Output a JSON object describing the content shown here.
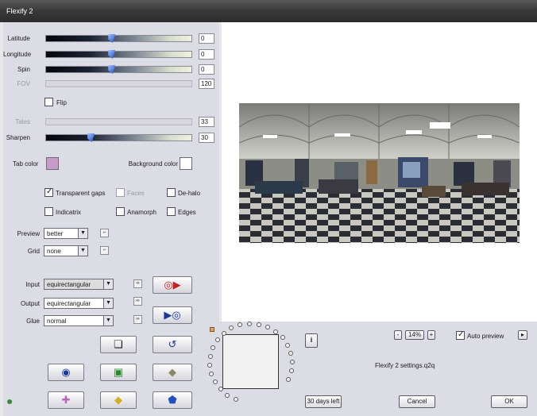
{
  "window": {
    "title": "Flexify 2"
  },
  "sliders": [
    {
      "label": "Latitude",
      "value": "0",
      "fraction": 0.45,
      "enabled": true
    },
    {
      "label": "Longitude",
      "value": "0",
      "fraction": 0.45,
      "enabled": true
    },
    {
      "label": "Spin",
      "value": "0",
      "fraction": 0.45,
      "enabled": true
    },
    {
      "label": "FOV",
      "value": "120",
      "fraction": 0.0,
      "enabled": false
    },
    {
      "label": "Tales",
      "value": "33",
      "fraction": 0.0,
      "enabled": false
    },
    {
      "label": "Sharpen",
      "value": "30",
      "fraction": 0.3,
      "enabled": true
    }
  ],
  "flip": {
    "label": "Flip",
    "checked": false
  },
  "colors": {
    "tab_label": "Tab color",
    "tab_color": "#c89cc8",
    "background_label": "Background color",
    "background_color": "#ffffff"
  },
  "options": {
    "transparent_gaps": {
      "label": "Transparent gaps",
      "checked": true
    },
    "faces": {
      "label": "Faces",
      "checked": false,
      "enabled": false
    },
    "dehalo": {
      "label": "De-halo",
      "checked": false
    },
    "indicatrix": {
      "label": "Indicatrix",
      "checked": false
    },
    "anamorph": {
      "label": "Anamorph",
      "checked": false
    },
    "edges": {
      "label": "Edges",
      "checked": false
    }
  },
  "preview_select": {
    "label": "Preview",
    "value": "better"
  },
  "grid_select": {
    "label": "Grid",
    "value": "none"
  },
  "input_select": {
    "label": "Input",
    "value": "equirectangular"
  },
  "output_select": {
    "label": "Output",
    "value": "equirectangular"
  },
  "glue_select": {
    "label": "Glue",
    "value": "normal"
  },
  "bottom": {
    "zoom": "14%",
    "zoom_minus": "-",
    "zoom_plus": "+",
    "auto_preview": {
      "label": "Auto preview",
      "checked": true
    },
    "settings_file": "Flexify 2 settings.q2q",
    "trial_button": "30 days left",
    "cancel_button": "Cancel",
    "ok_button": "OK",
    "info_label": "i"
  },
  "accent": "#1e4ec4"
}
